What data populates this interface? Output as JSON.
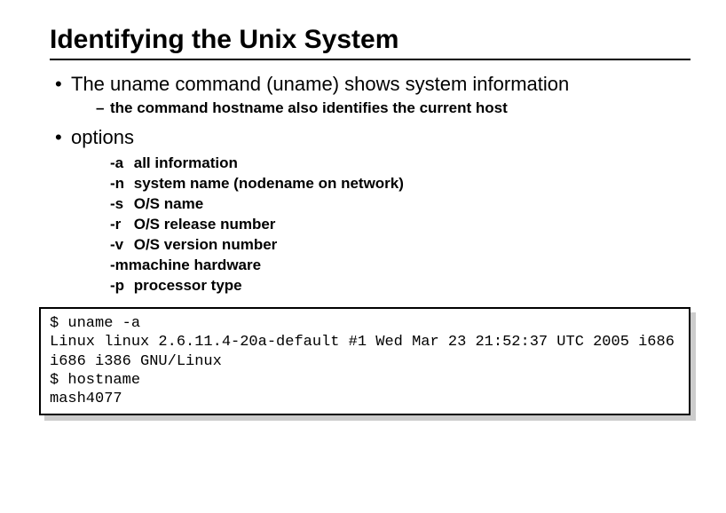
{
  "title": "Identifying the Unix System",
  "bullet1": "The uname command (uname) shows system information",
  "sub1": "the command hostname also identifies the current host",
  "bullet2": "options",
  "options": [
    {
      "flag": "-a",
      "desc": "all information"
    },
    {
      "flag": "-n",
      "desc": "system name (nodename on network)"
    },
    {
      "flag": "-s",
      "desc": "O/S name"
    },
    {
      "flag": "-r",
      "desc": "O/S release number"
    },
    {
      "flag": "-v",
      "desc": "O/S version number"
    },
    {
      "flag": "-m",
      "desc": "machine hardware"
    },
    {
      "flag": "-p",
      "desc": "processor type"
    }
  ],
  "terminal": {
    "line1": "$ uname -a",
    "line2": "Linux linux 2.6.11.4-20a-default #1 Wed Mar 23 21:52:37 UTC 2005 i686 i686 i386 GNU/Linux",
    "line3": "$ hostname",
    "line4": "mash4077"
  }
}
